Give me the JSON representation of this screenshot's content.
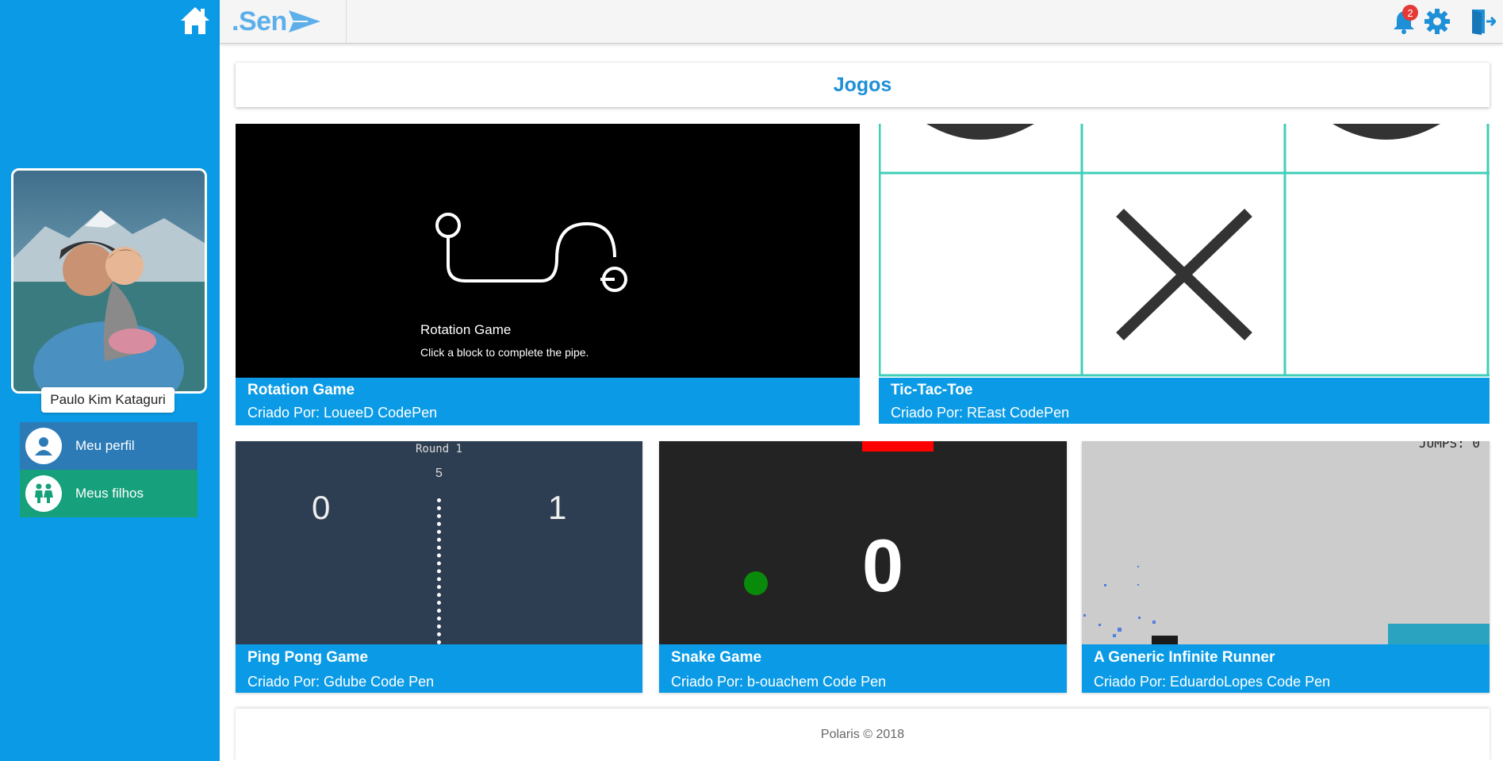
{
  "app": {
    "logo_text": ".Sen",
    "notification_count": "2"
  },
  "sidebar": {
    "user_name": "Paulo Kim Kataguri",
    "menu": [
      {
        "label": "Meu perfil",
        "icon": "user-icon"
      },
      {
        "label": "Meus filhos",
        "icon": "children-icon"
      }
    ]
  },
  "page": {
    "title": "Jogos"
  },
  "games": [
    {
      "name": "Rotation Game",
      "author": "Criado Por: LoueeD CodePen",
      "preview": {
        "title": "Rotation Game",
        "subtitle": "Click a block to complete the pipe."
      }
    },
    {
      "name": "Tic-Tac-Toe",
      "author": "Criado Por: REast CodePen"
    },
    {
      "name": "Ping Pong Game",
      "author": "Criado Por: Gdube Code Pen",
      "preview": {
        "round": "Round 1",
        "timer": "5",
        "score_left": "0",
        "score_right": "1"
      }
    },
    {
      "name": "Snake Game",
      "author": "Criado Por: b-ouachem Code Pen",
      "preview": {
        "score": "0"
      }
    },
    {
      "name": "A Generic Infinite Runner",
      "author": "Criado Por: EduardoLopes Code Pen",
      "preview": {
        "jumps": "JUMPS: 0"
      }
    }
  ],
  "footer": {
    "text": "Polaris © 2018"
  },
  "colors": {
    "primary": "#0b9be6",
    "menu_profile": "#2c7bb7",
    "menu_children": "#17a07c",
    "badge": "#e53935",
    "ttt_grid": "#3fcfb8"
  }
}
